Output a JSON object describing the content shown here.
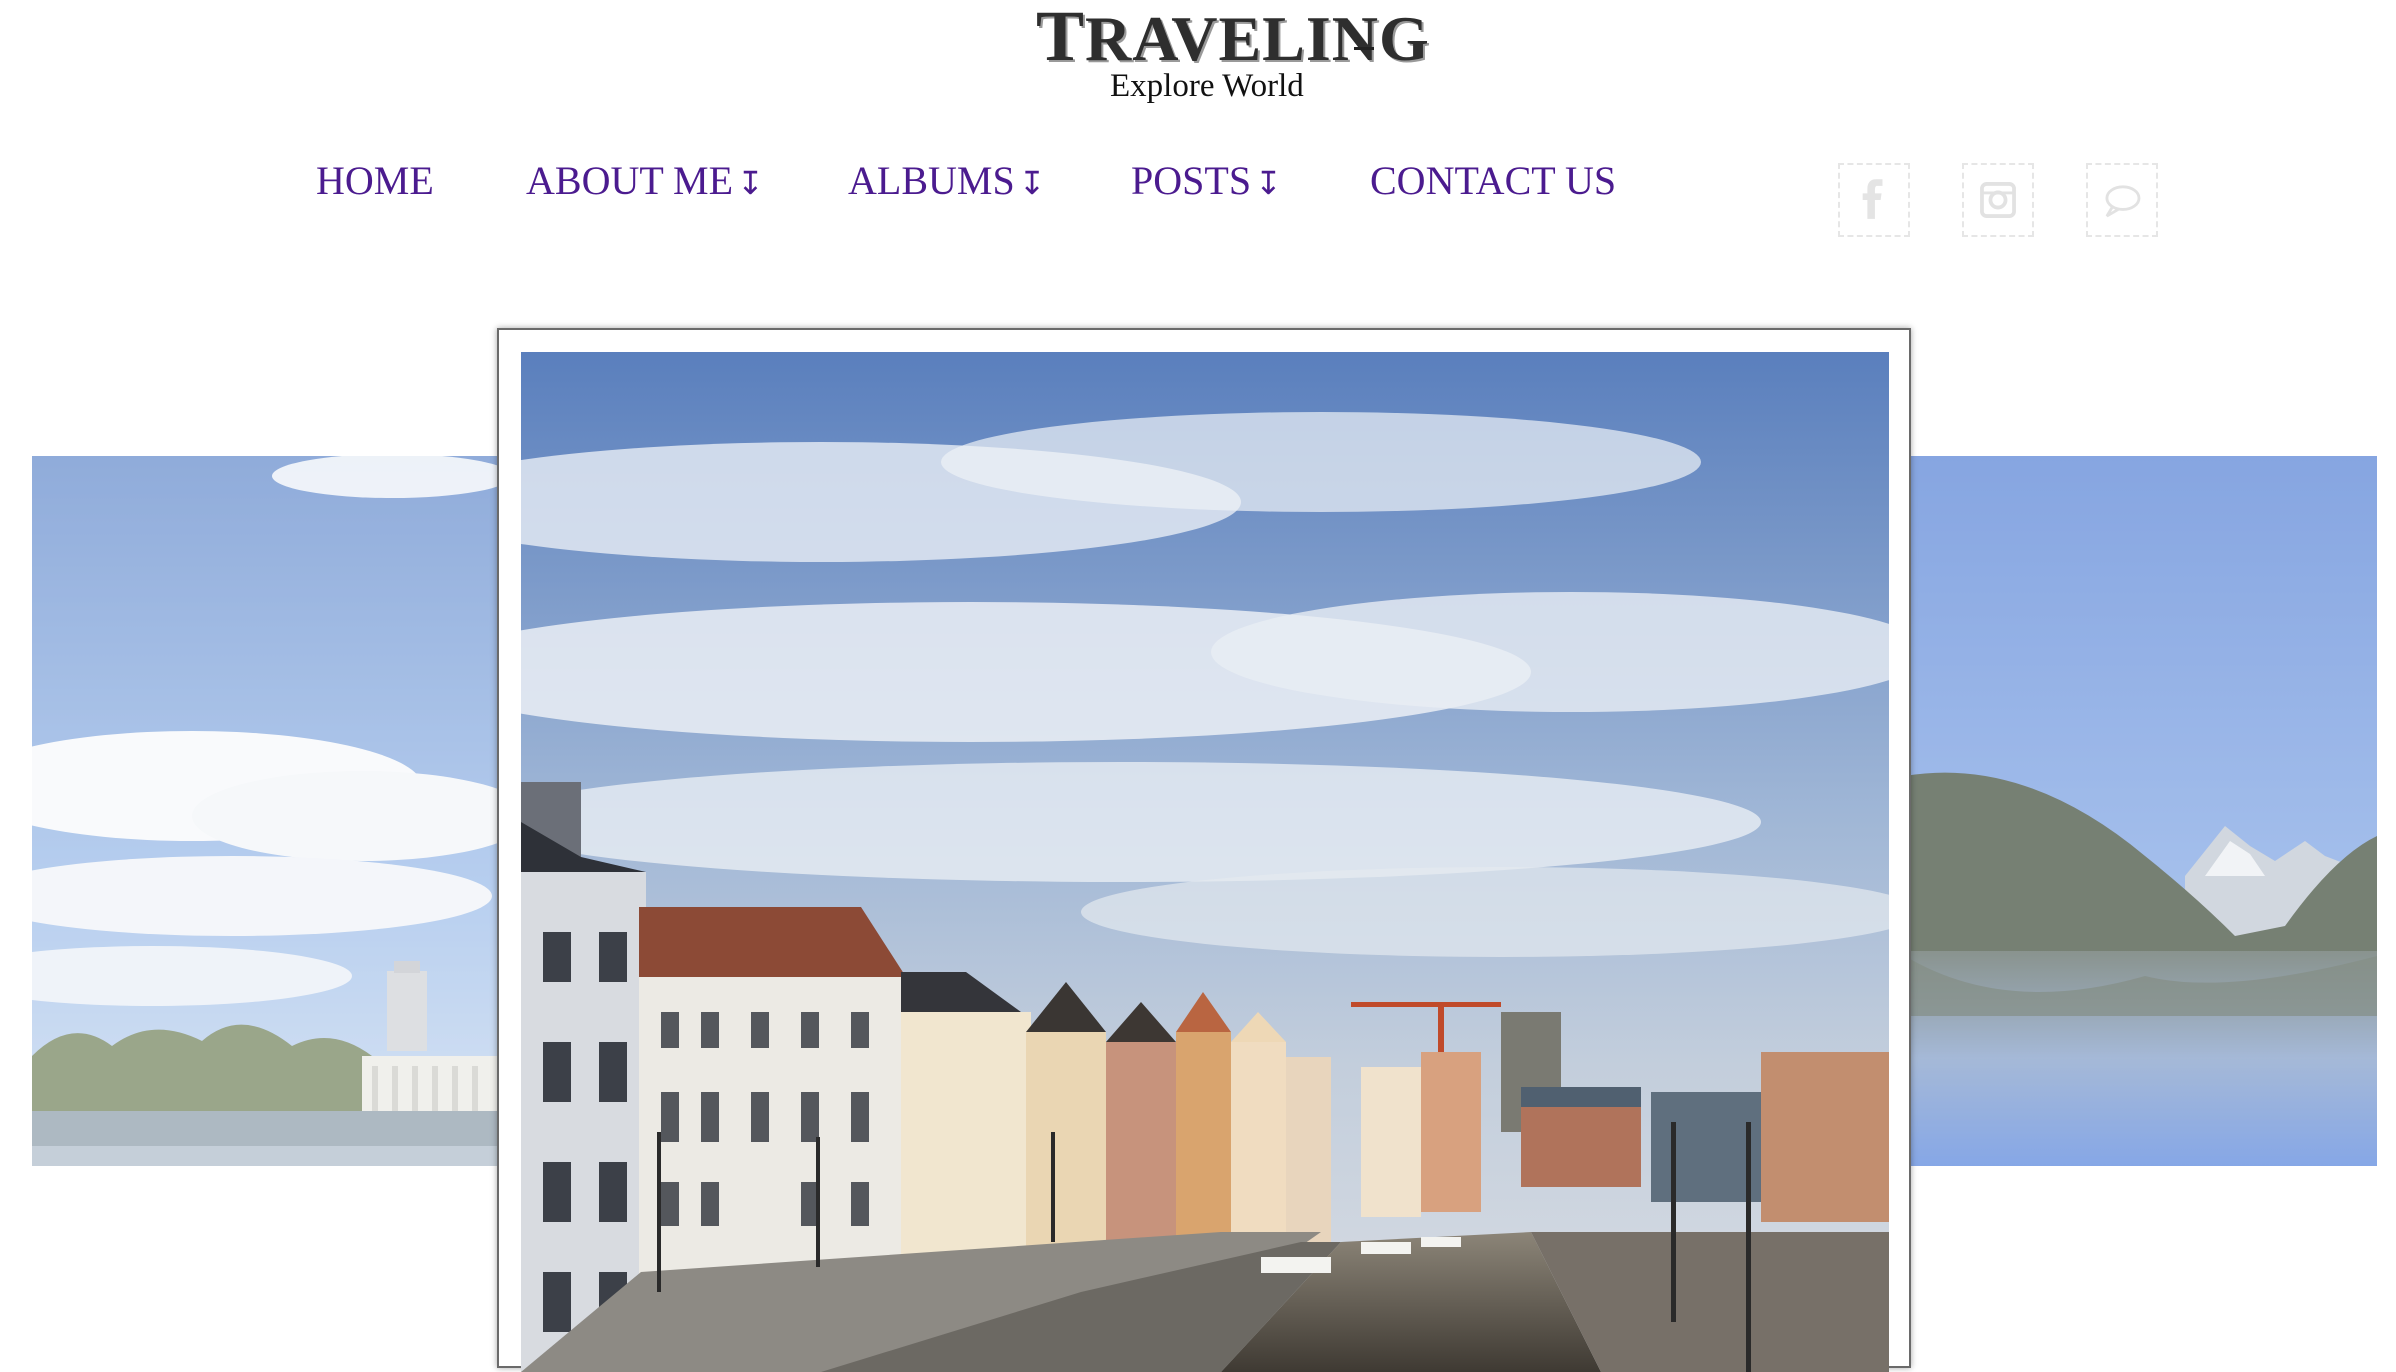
{
  "site": {
    "title": "TRAVELING",
    "subtitle": "Explore World"
  },
  "nav": {
    "items": [
      {
        "label": "HOME",
        "dropdown": false
      },
      {
        "label": "ABOUT ME",
        "dropdown": true
      },
      {
        "label": "ALBUMS",
        "dropdown": true
      },
      {
        "label": "POSTS",
        "dropdown": true
      },
      {
        "label": "CONTACT US",
        "dropdown": false
      }
    ],
    "dropdown_glyph": "↧",
    "color": "#4b1b8f"
  },
  "social": [
    {
      "icon": "facebook-icon"
    },
    {
      "icon": "instagram-icon"
    },
    {
      "icon": "chat-icon"
    }
  ],
  "slider": {
    "slides": [
      {
        "description_icon": "lake-city-photo",
        "state": "previous"
      },
      {
        "description_icon": "canal-city-photo",
        "state": "active"
      },
      {
        "description_icon": "mountain-lake-photo",
        "state": "next"
      }
    ]
  }
}
